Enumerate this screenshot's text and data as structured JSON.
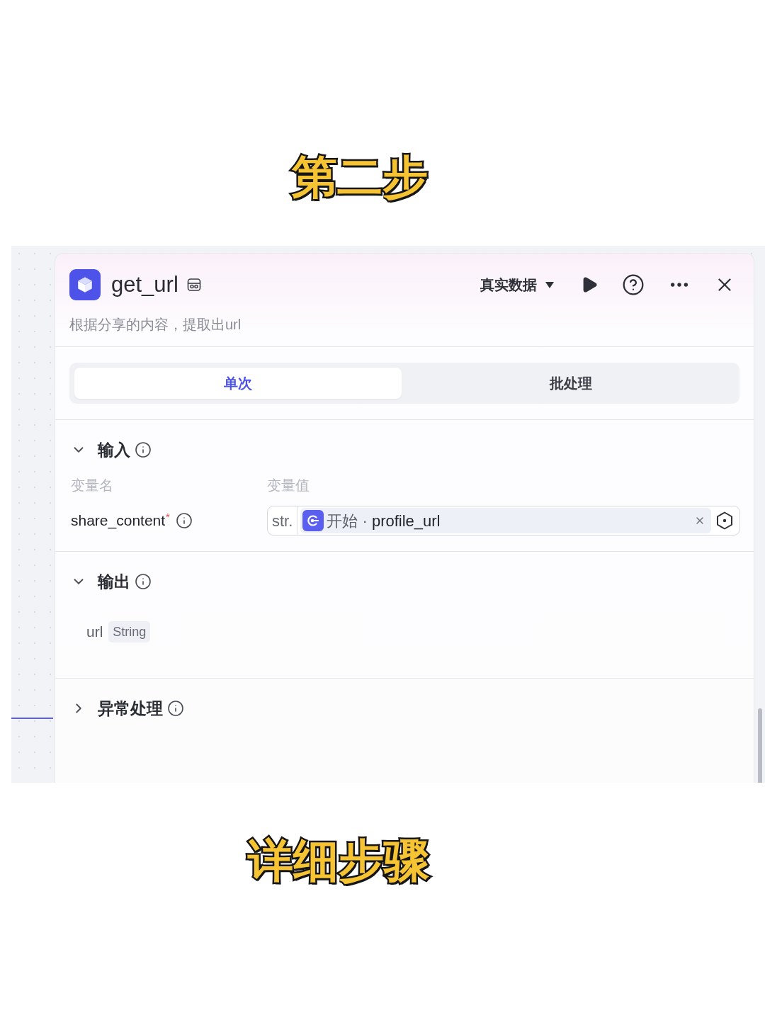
{
  "video_title": "第二步",
  "node_panel": {
    "title": "get_url",
    "description": "根据分享的内容，提取出url",
    "data_source": "真实数据",
    "tabs": [
      {
        "label": "单次",
        "selected": true
      },
      {
        "label": "批处理",
        "selected": false
      }
    ],
    "sections": [
      {
        "kind": "inputs",
        "title": "输入",
        "expanded": true,
        "columns": [
          "变量名",
          "变量值"
        ],
        "rows": [
          {
            "name": "share_content",
            "required_mark": "*",
            "type": "str.",
            "reference": "开始 · **profile_url**"
          }
        ]
      },
      {
        "kind": "outputs",
        "title": "输出",
        "expanded": true,
        "fields": [
          {
            "name": "url",
            "type": "String"
          }
        ]
      },
      {
        "kind": "error_handling",
        "title": "异常处理",
        "expanded": false
      }
    ]
  },
  "caption": "详细步骤"
}
